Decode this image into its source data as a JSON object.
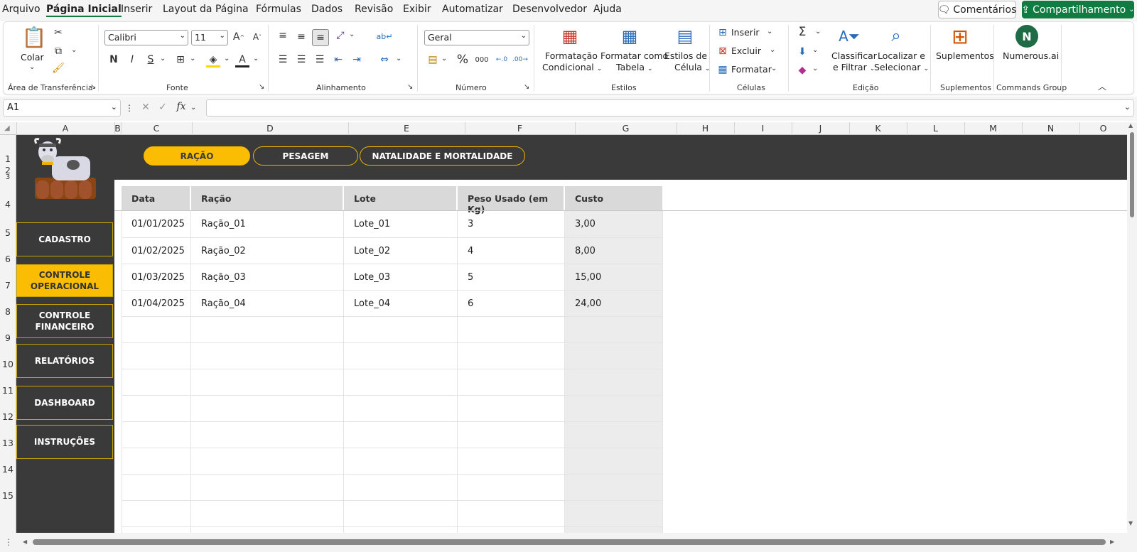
{
  "menu": [
    "Arquivo",
    "Página Inicial",
    "Inserir",
    "Layout da Página",
    "Fórmulas",
    "Dados",
    "Revisão",
    "Exibir",
    "Automatizar",
    "Desenvolvedor",
    "Ajuda"
  ],
  "topbuttons": {
    "comments": "Comentários",
    "share": "Compartilhamento"
  },
  "ribbon": {
    "clipboard": {
      "paste": "Colar",
      "label": "Área de Transferência"
    },
    "font": {
      "name": "Calibri",
      "size": "11",
      "label": "Fonte"
    },
    "alignment": {
      "label": "Alinhamento"
    },
    "number": {
      "format": "Geral",
      "label": "Número"
    },
    "styles": {
      "cond1": "Formatação",
      "cond2": "Condicional",
      "table1": "Formatar como",
      "table2": "Tabela",
      "cell1": "Estilos de",
      "cell2": "Célula",
      "label": "Estilos"
    },
    "cells": {
      "insert": "Inserir",
      "delete": "Excluir",
      "format": "Formatar",
      "label": "Células"
    },
    "editing": {
      "sort1": "Classificar",
      "sort2": "e Filtrar",
      "find1": "Localizar e",
      "find2": "Selecionar",
      "label": "Edição"
    },
    "addins": {
      "btn": "Suplementos",
      "label": "Suplementos"
    },
    "numerous": {
      "btn": "Numerous.ai",
      "label": "Commands Group"
    }
  },
  "formula": {
    "namebox": "A1",
    "fx": "fx",
    "value": ""
  },
  "columns": [
    "A",
    "B",
    "C",
    "D",
    "E",
    "F",
    "G",
    "H",
    "I",
    "J",
    "K",
    "L",
    "M",
    "N",
    "O"
  ],
  "rows": [
    "1",
    "2",
    "3",
    "4",
    "5",
    "6",
    "7",
    "8",
    "9",
    "10",
    "11",
    "12",
    "13",
    "14",
    "15"
  ],
  "tabs": [
    "RAÇÃO",
    "PESAGEM",
    "NATALIDADE E MORTALIDADE"
  ],
  "sidebar": [
    "CADASTRO",
    "CONTROLE OPERACIONAL",
    "CONTROLE FINANCEIRO",
    "RELATÓRIOS",
    "DASHBOARD",
    "INSTRUÇÕES"
  ],
  "table": {
    "headers": [
      "Data",
      "Ração",
      "Lote",
      "Peso Usado (em Kg)",
      "Custo"
    ],
    "rows": [
      [
        "01/01/2025",
        "Ração_01",
        "Lote_01",
        "3",
        "3,00"
      ],
      [
        "01/02/2025",
        "Ração_02",
        "Lote_02",
        "4",
        "8,00"
      ],
      [
        "01/03/2025",
        "Ração_03",
        "Lote_03",
        "5",
        "15,00"
      ],
      [
        "01/04/2025",
        "Ração_04",
        "Lote_04",
        "6",
        "24,00"
      ]
    ]
  },
  "colors": {
    "accent": "#fbbc04",
    "dark": "#3a3a3a",
    "excelGreen": "#107c41"
  }
}
